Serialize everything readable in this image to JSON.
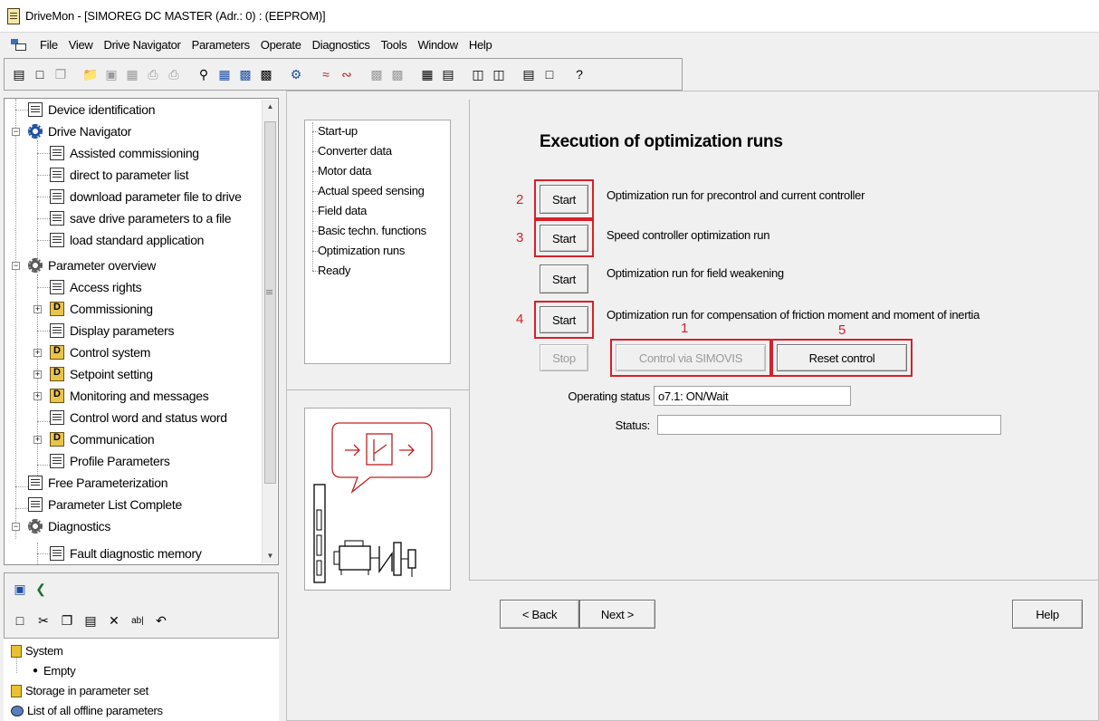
{
  "window": {
    "title": "DriveMon - [SIMOREG DC MASTER (Adr.: 0) : (EEPROM)]"
  },
  "menu": [
    "File",
    "View",
    "Drive Navigator",
    "Parameters",
    "Operate",
    "Diagnostics",
    "Tools",
    "Window",
    "Help"
  ],
  "toolbar_icons": [
    "new-list-icon",
    "new-doc-icon",
    "copy-doc-icon",
    "open-folder-icon",
    "save-icon",
    "properties-icon",
    "print-icon",
    "print-preview-icon",
    "bulb-icon",
    "network-icon",
    "network-online-icon",
    "drive-icon",
    "gear-icon",
    "trend-icon",
    "chart-icon",
    "upload-icon",
    "download-icon",
    "table-icon",
    "window-icon",
    "compare-icon",
    "compare2-icon",
    "split-icon",
    "single-icon",
    "help-icon"
  ],
  "tree": {
    "items": [
      {
        "label": "Device identification"
      },
      {
        "label": "Drive Navigator"
      },
      {
        "label": "Assisted commissioning"
      },
      {
        "label": "direct to parameter list"
      },
      {
        "label": "download parameter file to drive"
      },
      {
        "label": "save drive parameters to a file"
      },
      {
        "label": "load standard application"
      },
      {
        "label": "Parameter overview"
      },
      {
        "label": "Access rights"
      },
      {
        "label": "Commissioning"
      },
      {
        "label": "Display parameters"
      },
      {
        "label": "Control system"
      },
      {
        "label": "Setpoint setting"
      },
      {
        "label": "Monitoring and messages"
      },
      {
        "label": "Control word and status word"
      },
      {
        "label": "Communication"
      },
      {
        "label": "Profile Parameters"
      },
      {
        "label": "Free Parameterization"
      },
      {
        "label": "Parameter List Complete"
      },
      {
        "label": "Diagnostics"
      },
      {
        "label": "Fault diagnostic memory"
      }
    ]
  },
  "lower": {
    "toolbar2_icons": [
      "new-icon",
      "cut-icon",
      "copy-icon",
      "paste-icon",
      "delete-icon",
      "rename-icon",
      "undo-icon"
    ],
    "rows": [
      {
        "label": "System"
      },
      {
        "label": "Empty"
      },
      {
        "label": "Storage in parameter set"
      },
      {
        "label": "List of all offline parameters"
      }
    ]
  },
  "nav": {
    "items": [
      "Start-up",
      "Converter data",
      "Motor data",
      "Actual speed sensing",
      "Field data",
      "Basic techn. functions",
      "Optimization runs",
      "Ready"
    ]
  },
  "main": {
    "heading": "Execution of optimization runs",
    "runs": [
      {
        "number": "2",
        "button": "Start",
        "description": "Optimization run for precontrol and current controller"
      },
      {
        "number": "3",
        "button": "Start",
        "description": "Speed controller optimization run"
      },
      {
        "number": "",
        "button": "Start",
        "description": "Optimization run for field weakening"
      },
      {
        "number": "4",
        "button": "Start",
        "description": "Optimization run for compensation of friction moment and moment of inertia"
      }
    ],
    "stop_button": "Stop",
    "control_button": "Control via SIMOVIS",
    "control_number": "1",
    "reset_button": "Reset control",
    "reset_number": "5",
    "operating_status_label": "Operating status",
    "operating_status_value": "o7.1: ON/Wait",
    "status_label": "Status:",
    "status_value": ""
  },
  "footer": {
    "back": "< Back",
    "next": "Next >",
    "help": "Help"
  },
  "colors": {
    "annotation_red": "#d6202a"
  }
}
